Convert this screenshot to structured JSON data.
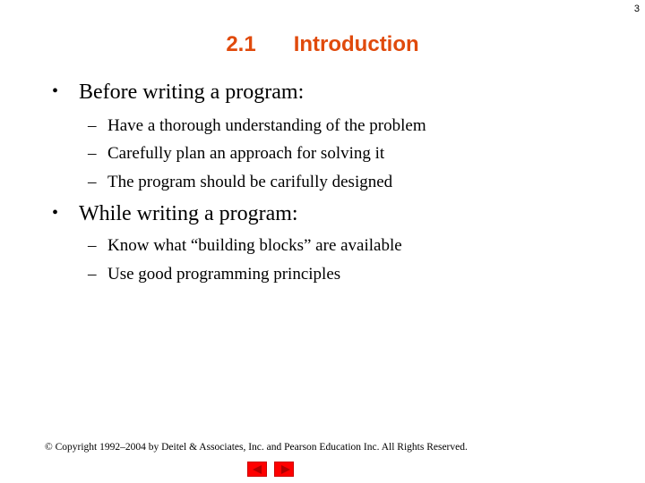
{
  "page_number": "3",
  "title": {
    "number": "2.1",
    "text": "Introduction"
  },
  "sections": [
    {
      "bullet": "Before writing a program:",
      "items": [
        "Have a thorough understanding of the problem",
        "Carefully plan an approach for solving it",
        "The program should be carifully designed"
      ]
    },
    {
      "bullet": "While writing a program:",
      "items": [
        "Know what “building blocks” are available",
        "Use good programming principles"
      ]
    }
  ],
  "symbols": {
    "bullet": "•",
    "dash": "–"
  },
  "footer": {
    "copyright": "© Copyright 1992–2004 by Deitel & Associates, Inc. and Pearson Education Inc. All Rights Reserved.",
    "nav": {
      "prev_icon": "triangle-left",
      "next_icon": "triangle-right",
      "color": "#ff0000"
    }
  },
  "colors": {
    "title": "#e04a0c"
  }
}
